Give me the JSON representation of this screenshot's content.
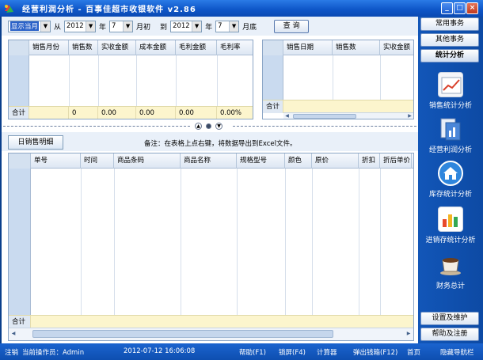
{
  "window": {
    "title": "经营利润分析 - 百事佳超市收银软件 v2.86",
    "controls": [
      "_",
      "□",
      "×"
    ]
  },
  "toolbar": {
    "period_select": "显示当月",
    "from_label": "从",
    "from_year": "2012",
    "year_label": "年",
    "from_month": "7",
    "month_start_label": "月初",
    "to_label": "到",
    "to_year": "2012",
    "to_month": "7",
    "month_end_label": "月底",
    "query_button": "查 询"
  },
  "summary_table": {
    "columns": [
      "销售月份",
      "销售数",
      "实收金额",
      "成本金额",
      "毛利金额",
      "毛利率"
    ],
    "total_label": "合计",
    "totals": [
      "",
      "0",
      "0.00",
      "0.00",
      "0.00",
      "0.00%"
    ]
  },
  "daily_table": {
    "columns": [
      "销售日期",
      "销售数",
      "实收金额"
    ],
    "total_label": "合计"
  },
  "detail": {
    "tab_label": "日销售明细",
    "note": "备注：在表格上点右键，将数据导出到Excel文件。",
    "columns": [
      "单号",
      "时间",
      "商品条码",
      "商品名称",
      "规格型号",
      "颜色",
      "原价",
      "折扣",
      "折后单价"
    ],
    "total_label": "合计"
  },
  "sidebar": {
    "top_buttons": [
      "常用事务",
      "其他事务",
      "统计分析"
    ],
    "nav_items": [
      "销售统计分析",
      "经营利润分析",
      "库存统计分析",
      "进销存统计分析",
      "财务总计"
    ],
    "bottom_buttons": [
      "设置及维护",
      "帮助及注册"
    ]
  },
  "statusbar": {
    "logout": "注销",
    "operator": "当前操作员：Admin",
    "datetime": "2012-07-12 16:06:08",
    "links": [
      "帮助(F1)",
      "锁屏(F4)",
      "计算器",
      "弹出钱箱(F12)",
      "首页",
      "隐藏导航栏"
    ]
  },
  "colors": {
    "titlebar": "#0f57c9",
    "sidebar": "#1256b8",
    "total_row": "#fcf5cd",
    "row_header": "#c9daef"
  },
  "icons": {
    "sales": "line-chart-icon",
    "profit": "document-chart-icon",
    "inventory": "home-icon",
    "inout": "bar-chart-icon",
    "finance": "coffee-cup-icon"
  }
}
